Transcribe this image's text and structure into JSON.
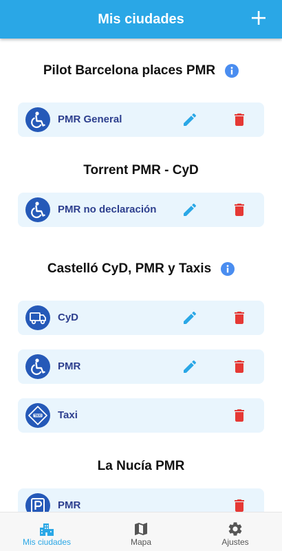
{
  "appbar": {
    "title": "Mis ciudades",
    "add_icon": "plus-icon"
  },
  "colors": {
    "primary": "#2aa7e6",
    "card_bg": "#e9f5fd",
    "avatar_bg": "#2559b8",
    "label": "#2d3f8e",
    "edit": "#2aa7e6",
    "delete": "#e53935",
    "info": "#4a8df0"
  },
  "groups": [
    {
      "title": "Pilot Barcelona places PMR",
      "has_info": true,
      "items": [
        {
          "label": "PMR General",
          "icon": "wheelchair-icon",
          "editable": true,
          "deletable": true
        }
      ]
    },
    {
      "title": "Torrent PMR - CyD",
      "has_info": false,
      "items": [
        {
          "label": "PMR no declaración",
          "icon": "wheelchair-icon",
          "editable": true,
          "deletable": true
        }
      ]
    },
    {
      "title": "Castelló CyD, PMR y Taxis",
      "has_info": true,
      "items": [
        {
          "label": "CyD",
          "icon": "delivery-truck-icon",
          "editable": true,
          "deletable": true
        },
        {
          "label": "PMR",
          "icon": "wheelchair-icon",
          "editable": true,
          "deletable": true
        },
        {
          "label": "Taxi",
          "icon": "taxi-sign-icon",
          "editable": false,
          "deletable": true
        }
      ]
    },
    {
      "title": "La Nucía PMR",
      "has_info": false,
      "items": [
        {
          "label": "PMR",
          "icon": "parking-icon",
          "editable": false,
          "deletable": true
        }
      ]
    }
  ],
  "bottom_nav": [
    {
      "label": "Mis ciudades",
      "icon": "city-buildings-icon",
      "active": true
    },
    {
      "label": "Mapa",
      "icon": "map-icon",
      "active": false
    },
    {
      "label": "Ajustes",
      "icon": "gear-icon",
      "active": false
    }
  ]
}
